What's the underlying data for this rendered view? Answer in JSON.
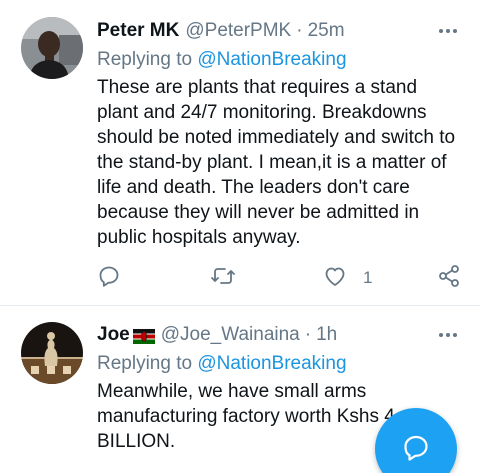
{
  "tweets": [
    {
      "name": "Peter MK",
      "handle": "@PeterPMK",
      "separator": "·",
      "time": "25m",
      "replying_prefix": "Replying to ",
      "replying_to": "@NationBreaking",
      "text": "These are plants that requires a stand plant and 24/7 monitoring. Breakdowns should be noted immediately and switch to the stand-by plant. I mean,it is a matter of life and death. The leaders don't care because they will never be admitted in public hospitals anyway.",
      "like_count": "1"
    },
    {
      "name": "Joe",
      "handle": "@Joe_Wainaina",
      "separator": "·",
      "time": "1h",
      "replying_prefix": "Replying to ",
      "replying_to": "@NationBreaking",
      "text": "Meanwhile, we have small arms manufacturing factory worth Kshs 4 BILLION."
    }
  ],
  "icons": {
    "reply": "reply-icon",
    "retweet": "retweet-icon",
    "like": "heart-icon",
    "share": "share-icon",
    "more": "more-icon",
    "compose": "compose-icon",
    "flag": "kenya-flag-icon"
  },
  "colors": {
    "link": "#1b95e0",
    "muted": "#657786",
    "fab": "#1da1f2"
  }
}
